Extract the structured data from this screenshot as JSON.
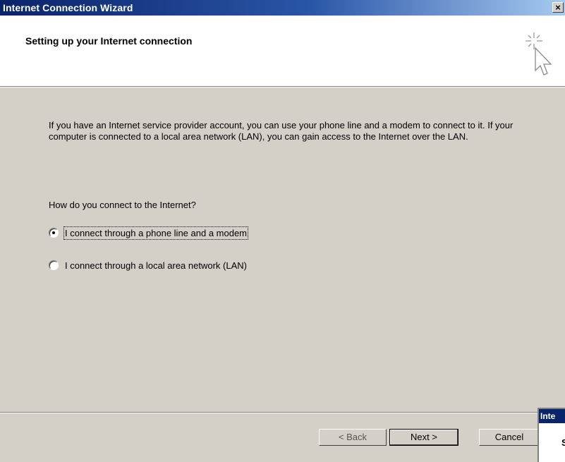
{
  "window": {
    "title": "Internet Connection Wizard",
    "close_label": "×"
  },
  "header": {
    "heading": "Setting up your Internet connection",
    "icon": "wizard-sparkle-cursor-icon"
  },
  "main": {
    "intro": "If you have an Internet service provider account, you can use your phone line and a modem to connect to it. If your computer is connected to a local area network (LAN), you can gain access to the Internet over the LAN.",
    "question": "How do you connect to the Internet?",
    "options": [
      {
        "label": "I connect through a phone line and a modem",
        "selected": true
      },
      {
        "label": "I connect through a local area network (LAN)",
        "selected": false
      }
    ]
  },
  "footer": {
    "back_label": "< Back",
    "next_label": "Next >",
    "cancel_label": "Cancel"
  },
  "overlay": {
    "title": "Inte",
    "letter": "S"
  },
  "colors": {
    "title_start": "#0a246a",
    "title_end": "#a6caf0",
    "dialog_bg": "#d4d0c8"
  }
}
